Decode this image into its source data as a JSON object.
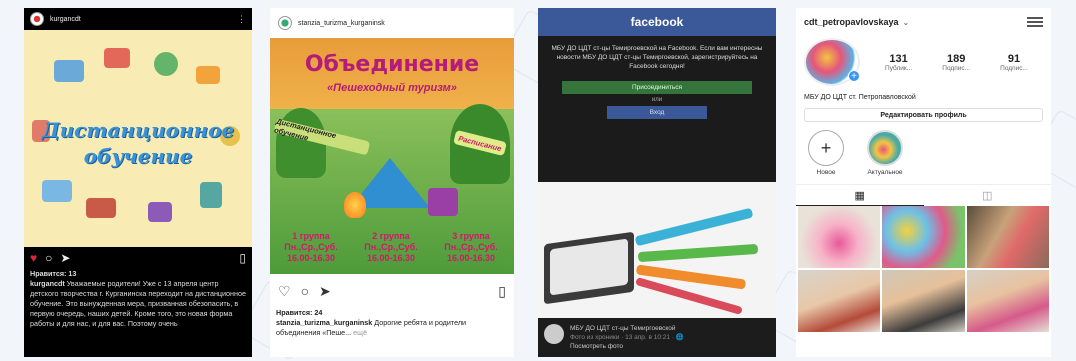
{
  "panel1": {
    "username": "kurgancdt",
    "art_line1": "Дистанционное",
    "art_line2": "обучение",
    "likes": "Нравится: 13",
    "caption_user": "kurgancdt",
    "caption_text": "Уважаемые родители! Уже с 13 апреля центр детского творчества г. Курганинска переходит на дистанционное обучение. Это вынужденная мера, призванная обезопасить, в первую очередь, наших детей. Кроме того, это новая форма работы и для нас, и для вас. Поэтому очень"
  },
  "panel2": {
    "username": "stanzia_turizma_kurganinsk",
    "title": "Объединение",
    "subtitle": "«Пешеходный туризм»",
    "banner_left": "Дистанционное обучение",
    "banner_right": "Расписание",
    "sched1_line1": "1 группа",
    "sched1_line2": "Пн.,Ср.,Суб.",
    "sched1_line3": "16.00-16.30",
    "sched2_line1": "2 группа",
    "sched2_line2": "Пн.,Ср.,Суб.",
    "sched2_line3": "16.00-16.30",
    "sched3_line1": "3 группа",
    "sched3_line2": "Пн.,Ср.,Суб.",
    "sched3_line3": "16.00-16.30",
    "likes": "Нравится: 24",
    "caption_user": "stanzia_turizma_kurganinsk",
    "caption_text": "Дорогие ребята и родители объединения «Пеше...",
    "more": "ещё"
  },
  "panel3": {
    "brand": "facebook",
    "text": "МБУ ДО ЦДТ ст-цы Темиргоевской на Facebook. Если вам интересны новости МБУ ДО ЦДТ ст-цы Темиргоевской, зарегистрируйтесь на Facebook сегодня!",
    "join_label": "Присоединиться",
    "or_label": "или",
    "login_label": "Вход",
    "foot_title": "МБУ ДО ЦДТ ст-цы Темиргоевской",
    "foot_meta": "Фото из хроники · 13 апр. в 10:21 · 🌐",
    "foot_link": "Посмотреть фото"
  },
  "panel4": {
    "username": "cdt_petropavlovskaya",
    "posts_n": "131",
    "posts_l": "Публик...",
    "followers_n": "189",
    "followers_l": "Подпис...",
    "following_n": "91",
    "following_l": "Подпис...",
    "bio": "МБУ ДО ЦДТ ст. Петропавловской",
    "edit_label": "Редактировать профиль",
    "hl_new": "Новое",
    "hl_actual": "Актуальное",
    "tab_grid_icon": "grid-icon",
    "tab_tagged_icon": "tagged-icon"
  },
  "colors": {
    "ig_heart": "#e02440",
    "fb_blue": "#3b5998",
    "fb_green": "#35743a",
    "p2_magenta": "#b41b7a",
    "p1_blue_text": "#3a93d6",
    "p1_bg": "#f8ecb4"
  }
}
